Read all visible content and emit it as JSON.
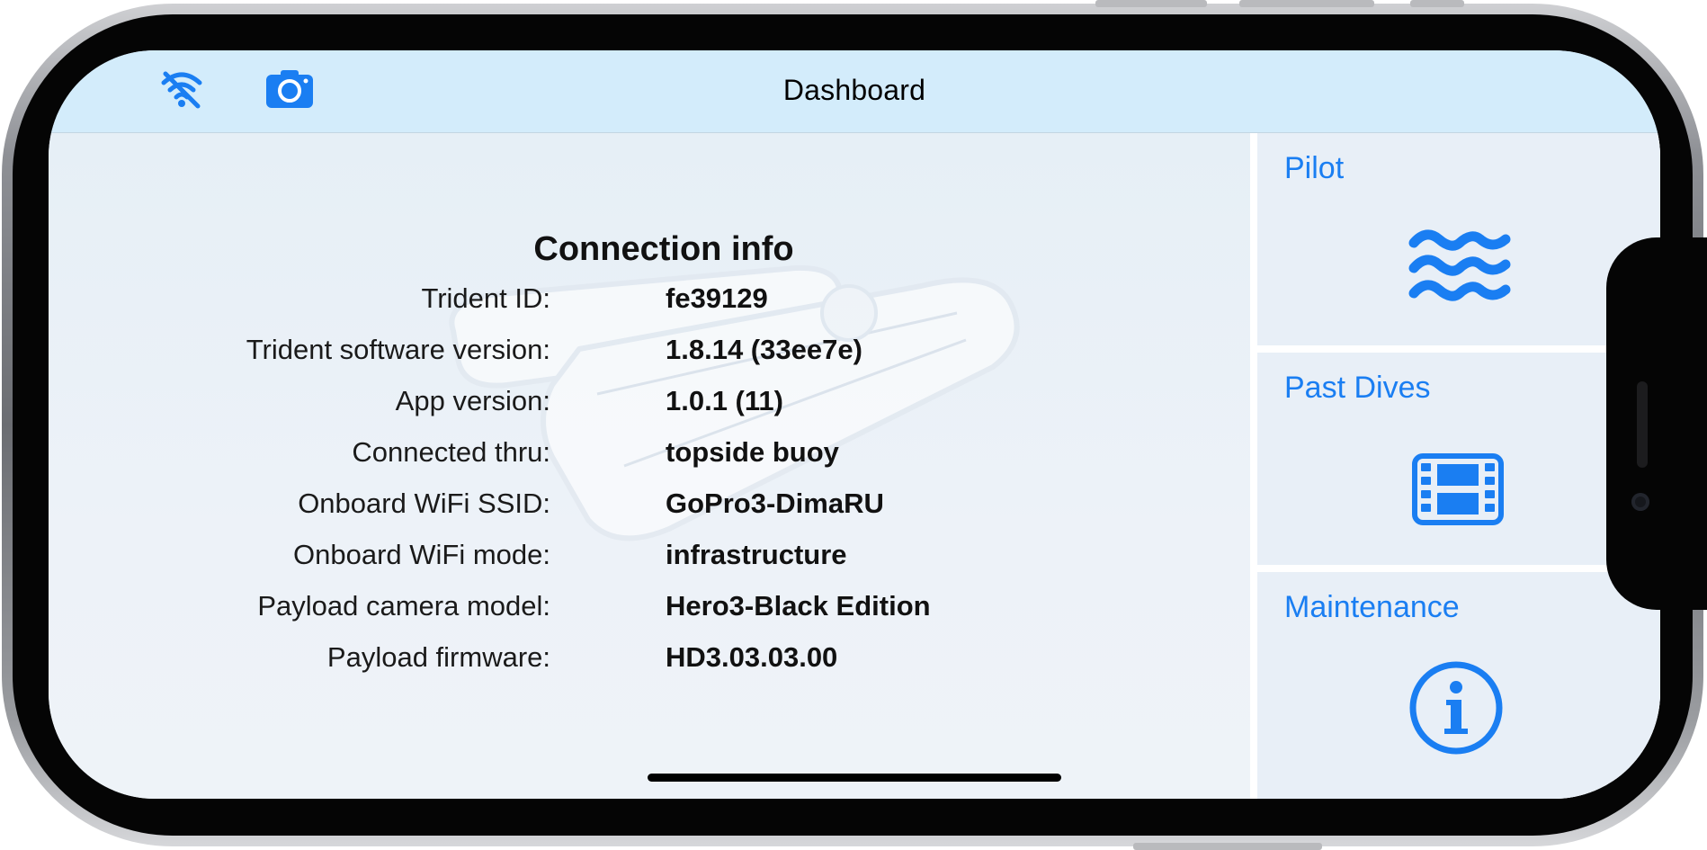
{
  "header": {
    "title": "Dashboard",
    "icons": [
      "wifi-off-icon",
      "camera-icon"
    ]
  },
  "connection_info": {
    "title": "Connection info",
    "rows": [
      {
        "label": "Trident ID:",
        "value": "fe39129"
      },
      {
        "label": "Trident software version:",
        "value": "1.8.14 (33ee7e)"
      },
      {
        "label": "App version:",
        "value": "1.0.1 (11)"
      },
      {
        "label": "Connected thru:",
        "value": "topside buoy"
      },
      {
        "label": "Onboard WiFi SSID:",
        "value": "GoPro3-DimaRU"
      },
      {
        "label": "Onboard WiFi mode:",
        "value": "infrastructure"
      },
      {
        "label": "Payload camera model:",
        "value": "Hero3-Black Edition"
      },
      {
        "label": "Payload firmware:",
        "value": "HD3.03.03.00"
      }
    ]
  },
  "sidebar": {
    "items": [
      {
        "label": "Pilot",
        "icon": "waves-icon"
      },
      {
        "label": "Past Dives",
        "icon": "film-icon"
      },
      {
        "label": "Maintenance",
        "icon": "info-icon"
      }
    ]
  },
  "colors": {
    "accent": "#1a7ef2",
    "navbar_bg": "#d3ecfb",
    "content_bg": "#eaf1f7"
  }
}
